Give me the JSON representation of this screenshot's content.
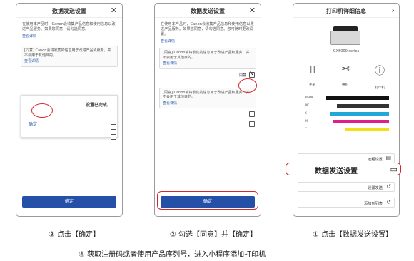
{
  "step1": {
    "caption": "① 点击【数据发送设置】",
    "screen_title": "打印机详细信息",
    "model": "GX5000 series",
    "icons": [
      {
        "label": "打印机",
        "icon": "info-icon"
      },
      {
        "label": "维护",
        "icon": "tools-icon"
      },
      {
        "label": "手册",
        "icon": "book-icon"
      }
    ],
    "ink_labels": [
      "PGBK",
      "BK",
      "C",
      "M",
      "Y"
    ],
    "ink_colors": [
      "#111111",
      "#333333",
      "#22a7d8",
      "#e0208a",
      "#f2e01b"
    ],
    "ink_levels": [
      0.85,
      0.7,
      0.8,
      0.75,
      0.6
    ],
    "menu": [
      "远程设置",
      "数据发送设置",
      "设置发送",
      "添加到列表"
    ],
    "highlight_label": "数据发送设置"
  },
  "step2": {
    "caption": "② 勾选【同意】并【确定】",
    "screen_title": "数据发送设置",
    "intro": "在使用本产品时，Canon会收集产品信息和使用信息以改进产品服务。如果您同意，请勾选同意。您可随时更改设置。",
    "link": "查看详情",
    "card_text": "[同意] Canon会将收集的信息用于改进产品和服务，并不会用于其他目的。",
    "card_link": "查看详情",
    "agree_label": "同意",
    "confirm_label": "确定"
  },
  "step3": {
    "caption": "③ 点击【确定】",
    "screen_title": "数据发送设置",
    "intro": "在使用本产品时，Canon会收集产品信息和使用信息以改进产品服务。如果您同意，请勾选同意。",
    "link": "查看详情",
    "popup_title": "设置已完成。",
    "popup_button": "确定",
    "agree_label": "同意",
    "confirm_label": "确定"
  },
  "footnote": "④ 获取注册码或者使用产品序列号，进入小程序添加打印机"
}
